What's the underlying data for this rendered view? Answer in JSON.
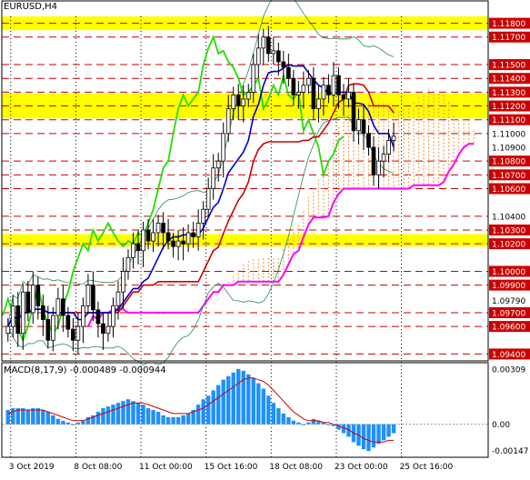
{
  "window": {
    "symbol_label": "EURUSD,H4",
    "macd_label": "MACD(8,17,9) -0.000489 -0.000944"
  },
  "colors": {
    "grid": "#000000",
    "support_line": "#cc0000",
    "zone_fill": "#ffff00",
    "tenkan": "#0000cc",
    "kijun": "#cc0000",
    "chikou": "#22dd00",
    "senkou_b": "#ff00ff",
    "cloud": "#f4a460",
    "bollinger": "#2e8b57",
    "macd_hist": "#1e90ff",
    "macd_signal": "#cc0000"
  },
  "chart_data": [
    {
      "type": "candlestick",
      "title": "EURUSD,H4",
      "ylim": [
        1.0935,
        1.1185
      ],
      "price_axis_labels": [
        "1.11800",
        "1.11700",
        "1.11500",
        "1.11400",
        "1.11300",
        "1.11200",
        "1.11100",
        "1.11000",
        "1.10900",
        "1.10800",
        "1.10700",
        "1.10600",
        "1.10400",
        "1.10300",
        "1.10200",
        "1.10000",
        "1.09900",
        "1.09790",
        "1.09700",
        "1.09600",
        "1.09400"
      ],
      "horizontal_levels": [
        1.118,
        1.117,
        1.115,
        1.114,
        1.113,
        1.112,
        1.111,
        1.11,
        1.108,
        1.107,
        1.106,
        1.104,
        1.103,
        1.102,
        1.1,
        1.099,
        1.097,
        1.096,
        1.094
      ],
      "highlight_zones": [
        [
          1.1175,
          1.1185
        ],
        [
          1.1111,
          1.1129
        ],
        [
          1.1018,
          1.1027
        ]
      ],
      "x_labels": [
        "3 Oct 2019",
        "8 Oct 08:00",
        "11 Oct 00:00",
        "15 Oct 16:00",
        "18 Oct 08:00",
        "23 Oct 00:00",
        "25 Oct 16:00"
      ],
      "close": [
        1.096,
        1.0975,
        1.0955,
        1.0985,
        1.097,
        1.099,
        1.0975,
        1.0965,
        1.095,
        1.0968,
        1.098,
        1.0968,
        1.0958,
        1.095,
        1.096,
        1.0975,
        1.099,
        1.0972,
        1.0962,
        1.0955,
        1.096,
        1.0975,
        1.0985,
        1.1,
        1.101,
        1.102,
        1.1015,
        1.103,
        1.1022,
        1.1028,
        1.1035,
        1.1028,
        1.1022,
        1.1018,
        1.1022,
        1.102,
        1.1028,
        1.1025,
        1.1035,
        1.1045,
        1.106,
        1.1075,
        1.108,
        1.11,
        1.1118,
        1.1128,
        1.112,
        1.1125,
        1.113,
        1.115,
        1.1162,
        1.117,
        1.1158,
        1.116,
        1.1152,
        1.1148,
        1.114,
        1.1128,
        1.113,
        1.1135,
        1.114,
        1.1118,
        1.1125,
        1.1135,
        1.1128,
        1.1142,
        1.1128,
        1.1125,
        1.113,
        1.1102,
        1.111,
        1.11,
        1.109,
        1.107,
        1.108,
        1.1085,
        1.1095,
        1.1098
      ],
      "macd": {
        "title": "MACD(8,17,9)",
        "main_value": -0.000489,
        "signal_value": -0.000944,
        "axis_labels": [
          "0.00309",
          "0.00",
          "-0.00147"
        ],
        "ylim": [
          -0.00185,
          0.0034
        ],
        "histogram": [
          0.0008,
          0.0009,
          0.0009,
          0.0009,
          0.0008,
          0.0009,
          0.0009,
          0.0008,
          0.0007,
          0.0005,
          0.0003,
          0.0002,
          0.0001,
          0.0,
          0.0001,
          0.0002,
          0.0004,
          0.0005,
          0.0007,
          0.0009,
          0.001,
          0.0011,
          0.0012,
          0.0013,
          0.0014,
          0.0013,
          0.0012,
          0.0011,
          0.0009,
          0.0008,
          0.0007,
          0.0005,
          0.0004,
          0.0004,
          0.0004,
          0.0005,
          0.0006,
          0.0008,
          0.0011,
          0.0014,
          0.0016,
          0.0019,
          0.0022,
          0.0025,
          0.0027,
          0.0029,
          0.0031,
          0.003,
          0.0028,
          0.0026,
          0.0023,
          0.002,
          0.0016,
          0.0012,
          0.0009,
          0.0006,
          0.0004,
          0.0002,
          0.0001,
          0.0,
          0.0001,
          0.0003,
          0.0002,
          0.0001,
          0.0,
          -0.0001,
          -0.0003,
          -0.0005,
          -0.0007,
          -0.001,
          -0.0012,
          -0.0014,
          -0.0015,
          -0.0013,
          -0.0011,
          -0.0009,
          -0.0007,
          -0.0005
        ],
        "signal": [
          0.0006,
          0.0007,
          0.0008,
          0.0008,
          0.0008,
          0.0008,
          0.0008,
          0.0008,
          0.0007,
          0.0006,
          0.0005,
          0.0004,
          0.0003,
          0.0002,
          0.0002,
          0.0002,
          0.0003,
          0.0004,
          0.0005,
          0.0006,
          0.0007,
          0.0008,
          0.0009,
          0.001,
          0.0011,
          0.0012,
          0.0012,
          0.0012,
          0.0011,
          0.001,
          0.0009,
          0.0008,
          0.0007,
          0.0006,
          0.0006,
          0.0006,
          0.0006,
          0.0007,
          0.0008,
          0.0009,
          0.0011,
          0.0013,
          0.0015,
          0.0017,
          0.0019,
          0.0021,
          0.0023,
          0.0025,
          0.0026,
          0.0026,
          0.0025,
          0.0024,
          0.0022,
          0.0019,
          0.0016,
          0.0013,
          0.001,
          0.0007,
          0.0005,
          0.0003,
          0.0002,
          0.0002,
          0.0002,
          0.0001,
          0.0001,
          0.0,
          -0.0001,
          -0.0002,
          -0.0003,
          -0.0005,
          -0.0006,
          -0.0008,
          -0.0009,
          -0.001,
          -0.001,
          -0.001,
          -0.0009,
          -0.0009
        ]
      }
    }
  ]
}
